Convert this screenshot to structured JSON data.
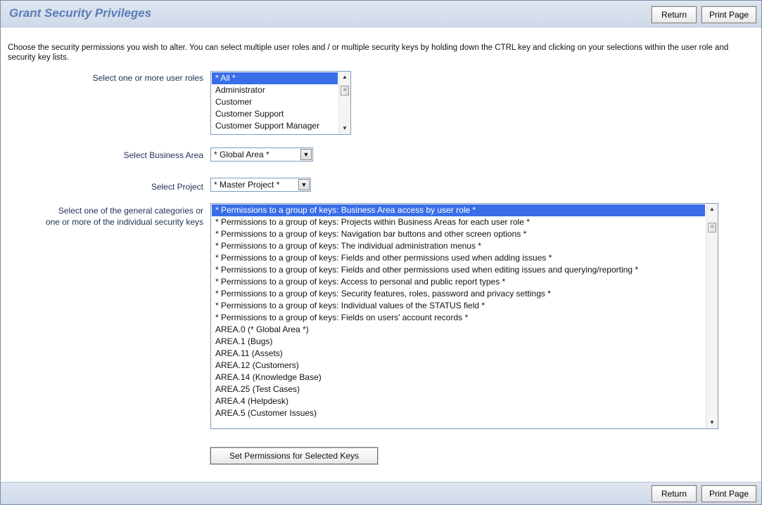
{
  "header": {
    "title": "Grant Security Privileges",
    "return_label": "Return",
    "print_label": "Print Page"
  },
  "intro": "Choose the security permissions you wish to alter. You can select multiple user roles and / or multiple security keys by holding down the CTRL key and clicking on your selections within the user role and security key lists.",
  "user_roles": {
    "label": "Select one or more user roles",
    "options": [
      "* All *",
      "Administrator",
      "Customer",
      "Customer Support",
      "Customer Support Manager"
    ],
    "selected": "* All *"
  },
  "business_area": {
    "label": "Select Business Area",
    "value": "* Global Area *"
  },
  "project": {
    "label": "Select Project",
    "value": "* Master Project *"
  },
  "security_keys": {
    "label_line1": "Select one of the general categories or",
    "label_line2": "one or more of the individual security keys",
    "options": [
      "* Permissions to a group of keys: Business Area access by user role *",
      "* Permissions to a group of keys: Projects within Business Areas for each user role *",
      "* Permissions to a group of keys: Navigation bar buttons and other screen options *",
      "* Permissions to a group of keys: The individual administration menus *",
      "* Permissions to a group of keys: Fields and other permissions used when adding issues *",
      "* Permissions to a group of keys: Fields and other permissions used when editing issues and querying/reporting *",
      "* Permissions to a group of keys: Access to personal and public report types *",
      "* Permissions to a group of keys: Security features, roles, password and privacy settings *",
      "* Permissions to a group of keys: Individual values of the STATUS field *",
      "* Permissions to a group of keys: Fields on users' account records *",
      "AREA.0 (* Global Area *)",
      "AREA.1 (Bugs)",
      "AREA.11 (Assets)",
      "AREA.12 (Customers)",
      "AREA.14 (Knowledge Base)",
      "AREA.25 (Test Cases)",
      "AREA.4 (Helpdesk)",
      "AREA.5 (Customer Issues)"
    ],
    "selected": "* Permissions to a group of keys: Business Area access by user role *"
  },
  "set_button_label": "Set Permissions for Selected Keys",
  "footer": {
    "return_label": "Return",
    "print_label": "Print Page"
  },
  "icons": {
    "scroll_up": "scroll-up-arrow-icon",
    "scroll_down": "scroll-down-arrow-icon",
    "dropdown": "chevron-down-icon"
  }
}
